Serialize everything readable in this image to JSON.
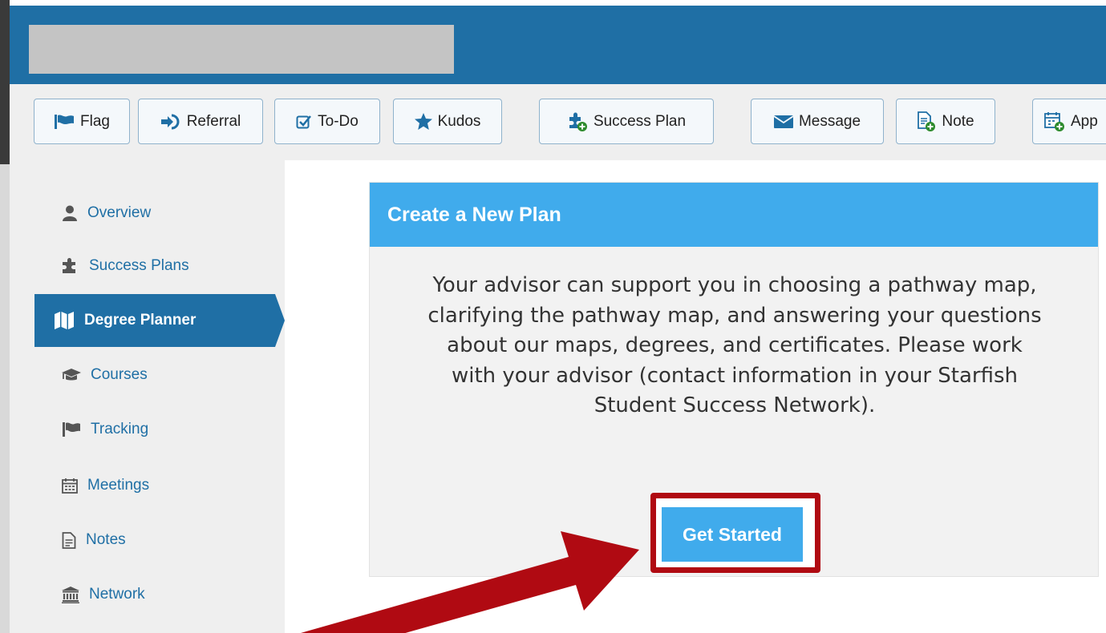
{
  "toolbar": {
    "buttons": [
      {
        "label": "Flag",
        "icon": "flag-icon"
      },
      {
        "label": "Referral",
        "icon": "arrow-right-circle-icon"
      },
      {
        "label": "To-Do",
        "icon": "checkbox-icon"
      },
      {
        "label": "Kudos",
        "icon": "star-icon"
      },
      {
        "label": "Success Plan",
        "icon": "puzzle-plus-icon"
      },
      {
        "label": "Message",
        "icon": "envelope-icon"
      },
      {
        "label": "Note",
        "icon": "note-plus-icon"
      },
      {
        "label": "App",
        "icon": "calendar-plus-icon"
      }
    ]
  },
  "sidebar": {
    "items": [
      {
        "label": "Overview",
        "icon": "user-icon"
      },
      {
        "label": "Success Plans",
        "icon": "puzzle-icon"
      },
      {
        "label": "Degree Planner",
        "icon": "map-icon",
        "active": true
      },
      {
        "label": "Courses",
        "icon": "graduation-cap-icon"
      },
      {
        "label": "Tracking",
        "icon": "flag-icon"
      },
      {
        "label": "Meetings",
        "icon": "calendar-icon"
      },
      {
        "label": "Notes",
        "icon": "document-icon"
      },
      {
        "label": "Network",
        "icon": "institution-icon"
      }
    ]
  },
  "main": {
    "card_title": "Create a New Plan",
    "card_lines": [
      "Your advisor can support you in choosing a pathway map,",
      "clarifying the pathway map, and answering your questions",
      "about our maps, degrees, and certificates. Please work",
      "with your advisor (contact information in your Starfish",
      "Student Success Network)."
    ],
    "get_started_label": "Get Started"
  },
  "colors": {
    "header": "#1f6fa5",
    "accent": "#40abec",
    "highlight": "#b00a12",
    "toolbar_bg": "#efefef"
  }
}
